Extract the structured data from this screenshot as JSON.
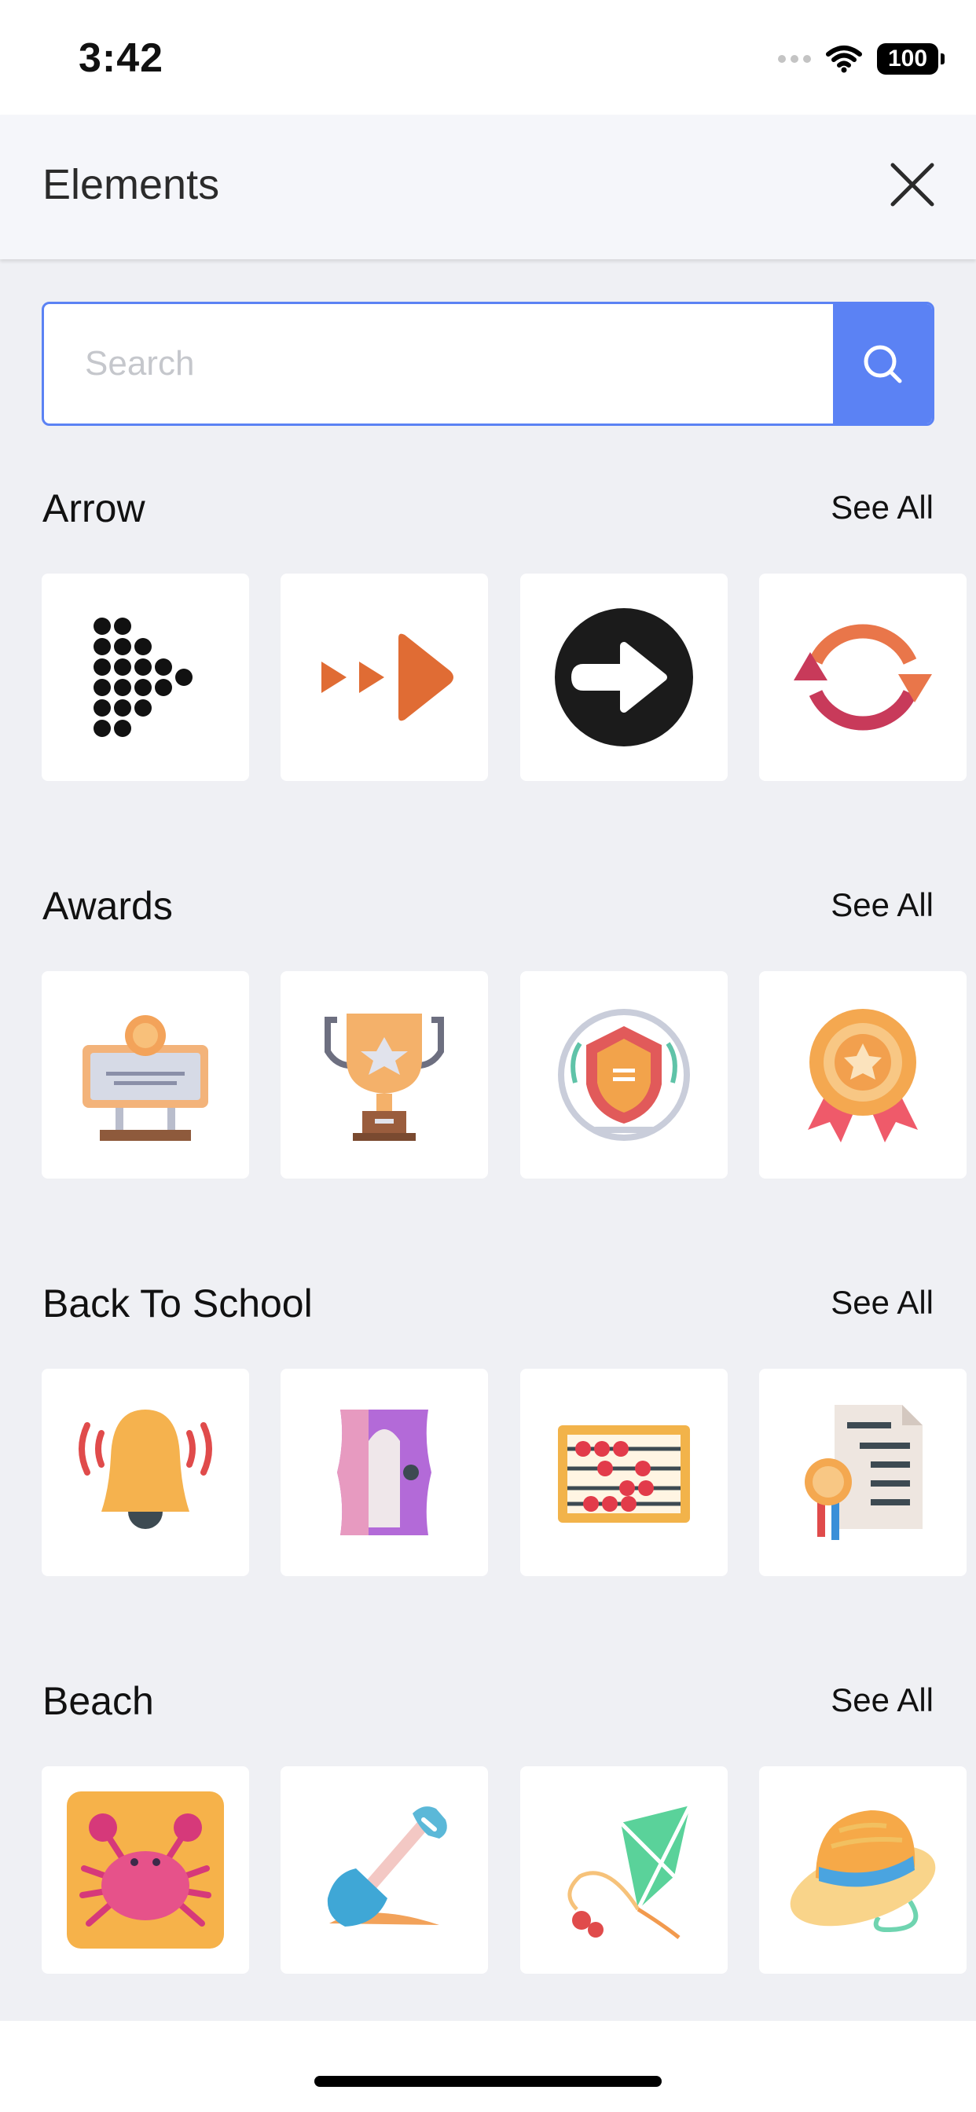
{
  "status_bar": {
    "time": "3:42",
    "battery": "100"
  },
  "header": {
    "title": "Elements"
  },
  "search": {
    "placeholder": "Search",
    "value": ""
  },
  "sections": [
    {
      "title": "Arrow",
      "see_all": "See All",
      "items": [
        "dot-arrow-icon",
        "fast-forward-icon",
        "circle-arrow-right-icon",
        "refresh-cycle-icon"
      ]
    },
    {
      "title": "Awards",
      "see_all": "See All",
      "items": [
        "award-plaque-icon",
        "trophy-icon",
        "shield-badge-icon",
        "medal-ribbon-icon"
      ]
    },
    {
      "title": "Back To School",
      "see_all": "See All",
      "items": [
        "bell-icon",
        "pencil-sharpener-icon",
        "abacus-icon",
        "certificate-icon"
      ]
    },
    {
      "title": "Beach",
      "see_all": "See All",
      "items": [
        "crab-icon",
        "shovel-icon",
        "kite-icon",
        "sun-hat-icon"
      ]
    }
  ],
  "colors": {
    "accent": "#5b82f4",
    "background": "#eff0f4",
    "arrow_orange": "#e06c34"
  }
}
